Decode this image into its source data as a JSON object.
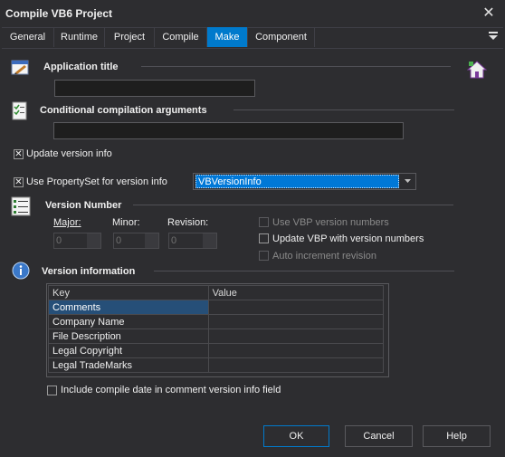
{
  "window": {
    "title": "Compile VB6 Project",
    "close_glyph": "✕"
  },
  "tabs": [
    {
      "label": "General"
    },
    {
      "label": "Runtime"
    },
    {
      "label": "Project"
    },
    {
      "label": "Compile"
    },
    {
      "label": "Make",
      "active": true
    },
    {
      "label": "Component"
    }
  ],
  "app_title": {
    "heading": "Application title",
    "value": ""
  },
  "conditional": {
    "heading": "Conditional compilation arguments",
    "value": ""
  },
  "update_version_info": {
    "label": "Update version info",
    "checked": true
  },
  "propertyset": {
    "label": "Use PropertySet for version info",
    "checked": true,
    "selected": "VBVersionInfo"
  },
  "version_number": {
    "heading": "Version Number",
    "major_label": "Major:",
    "minor_label": "Minor:",
    "revision_label": "Revision:",
    "major": "0",
    "minor": "0",
    "revision": "0",
    "use_vbp_label": "Use VBP version numbers",
    "update_vbp_label": "Update VBP with version numbers",
    "auto_increment_label": "Auto increment revision"
  },
  "version_information": {
    "heading": "Version information",
    "columns": [
      "Key",
      "Value"
    ],
    "rows": [
      {
        "key": "Comments",
        "value": ""
      },
      {
        "key": "Company Name",
        "value": ""
      },
      {
        "key": "File Description",
        "value": ""
      },
      {
        "key": "Legal Copyright",
        "value": ""
      },
      {
        "key": "Legal TradeMarks",
        "value": ""
      }
    ]
  },
  "include_date": {
    "label": "Include compile date in comment version info field",
    "checked": false
  },
  "buttons": {
    "ok": "OK",
    "cancel": "Cancel",
    "help": "Help"
  },
  "colors": {
    "accent": "#007acc",
    "background": "#2d2d30",
    "input": "#1e1e1e"
  },
  "icons": [
    "application-title-icon",
    "checklist-icon",
    "list-icon",
    "info-icon",
    "home-icon",
    "menu-icon",
    "close-icon"
  ]
}
